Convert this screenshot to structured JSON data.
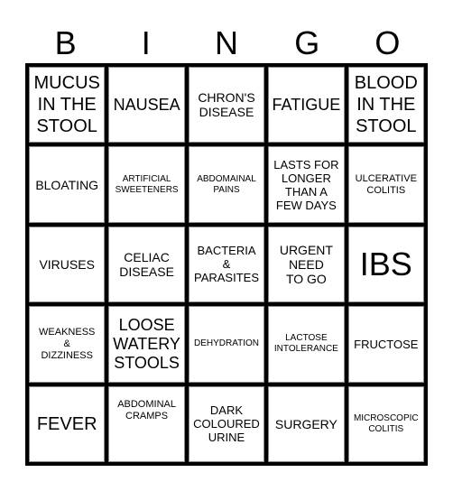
{
  "header": {
    "letters": [
      "B",
      "I",
      "N",
      "G",
      "O"
    ]
  },
  "cells": [
    {
      "text": "MUCUS\nIN THE\nSTOOL",
      "size": "l"
    },
    {
      "text": "NAUSEA",
      "size": "m"
    },
    {
      "text": "CHRON'S\nDISEASE",
      "size": "ms"
    },
    {
      "text": "FATIGUE",
      "size": "m"
    },
    {
      "text": "BLOOD\nIN THE\nSTOOL",
      "size": "l"
    },
    {
      "text": "BLOATING",
      "size": "ms"
    },
    {
      "text": "ARTIFICIAL\nSWEETENERS",
      "size": "xxs"
    },
    {
      "text": "ABDOMAINAL\nPAINS",
      "size": "xxs"
    },
    {
      "text": "LASTS FOR\nLONGER\nTHAN A\nFEW DAYS",
      "size": "s"
    },
    {
      "text": "ULCERATIVE\nCOLITIS",
      "size": "xs"
    },
    {
      "text": "VIRUSES",
      "size": "ms"
    },
    {
      "text": "CELIAC\nDISEASE",
      "size": "ms"
    },
    {
      "text": "BACTERIA\n&\nPARASITES",
      "size": "s"
    },
    {
      "text": "URGENT\nNEED\nTO GO",
      "size": "ms"
    },
    {
      "text": "IBS",
      "size": "xl"
    },
    {
      "text": "WEAKNESS\n&\nDIZZINESS",
      "size": "xs"
    },
    {
      "text": "LOOSE\nWATERY\nSTOOLS",
      "size": "m"
    },
    {
      "text": "DEHYDRATION",
      "size": "xxs"
    },
    {
      "text": "LACTOSE\nINTOLERANCE",
      "size": "xxs"
    },
    {
      "text": "FRUCTOSE",
      "size": "s"
    },
    {
      "text": "FEVER",
      "size": "l"
    },
    {
      "text": "ABDOMINAL\nCRAMPS",
      "size": "xs",
      "align": "top"
    },
    {
      "text": "DARK\nCOLOURED\nURINE",
      "size": "s"
    },
    {
      "text": "SURGERY",
      "size": "ms"
    },
    {
      "text": "MICROSCOPIC\nCOLITIS",
      "size": "xxs"
    }
  ]
}
